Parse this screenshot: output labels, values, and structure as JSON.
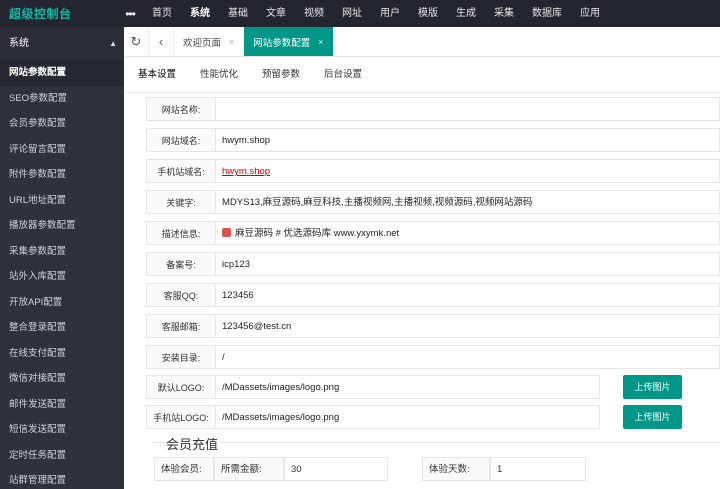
{
  "app": {
    "title": "超级控制台"
  },
  "topnav": {
    "more": "•••",
    "items": [
      "首页",
      "系统",
      "基础",
      "文章",
      "视频",
      "网址",
      "用户",
      "模版",
      "生成",
      "采集",
      "数据库",
      "应用"
    ],
    "active": 1
  },
  "sidebar": {
    "group": "系统",
    "items": [
      "网站参数配置",
      "SEO参数配置",
      "会员参数配置",
      "评论留言配置",
      "附件参数配置",
      "URL地址配置",
      "播放器参数配置",
      "采集参数配置",
      "站外入库配置",
      "开放API配置",
      "整合登录配置",
      "在线支付配置",
      "微信对接配置",
      "邮件发送配置",
      "短信发送配置",
      "定时任务配置",
      "站群管理配置"
    ],
    "active": 0
  },
  "tabs": {
    "refresh_icon": "refresh-icon",
    "back_icon": "back-icon",
    "items": [
      {
        "label": "欢迎页面",
        "close": "×"
      },
      {
        "label": "网站参数配置",
        "close": "×"
      }
    ],
    "active": 1
  },
  "subtabs": {
    "items": [
      "基本设置",
      "性能优化",
      "预留参数",
      "后台设置"
    ],
    "active": 0
  },
  "form": {
    "site_name": {
      "label": "网站名称:",
      "value": ""
    },
    "site_domain": {
      "label": "网站域名:",
      "value": "hwym.shop"
    },
    "mobile_domain": {
      "label": "手机站域名:",
      "value": "hwym.shop"
    },
    "keywords": {
      "label": "关键字:",
      "value": "MDYS13,麻豆源码,麻豆科技,主播视频网,主播视频,视频源码,视频网站源码"
    },
    "description": {
      "label": "描述信息:",
      "value": "麻豆源码 # 优选源码库 www.yxymk.net"
    },
    "icp": {
      "label": "备案号:",
      "value": "icp123"
    },
    "qq": {
      "label": "客服QQ:",
      "value": "123456"
    },
    "email": {
      "label": "客服邮箱:",
      "value": "123456@test.cn"
    },
    "install_dir": {
      "label": "安装目录:",
      "value": "/"
    },
    "logo": {
      "label": "默认LOGO:",
      "value": "/MDassets/images/logo.png",
      "button": "上传图片"
    },
    "mobile_logo": {
      "label": "手机站LOGO:",
      "value": "/MDassets/images/logo.png",
      "button": "上传图片"
    }
  },
  "vip": {
    "title": "会员充值",
    "trial_label": "体验会员:",
    "amount_label": "所需金额:",
    "amount_value": "30",
    "days_label": "体验天数:",
    "days_value": "1"
  },
  "colors": {
    "accent": "#009688",
    "topbar": "#23262e",
    "sidebar": "#2f323a",
    "logo": "#17b5a4"
  }
}
